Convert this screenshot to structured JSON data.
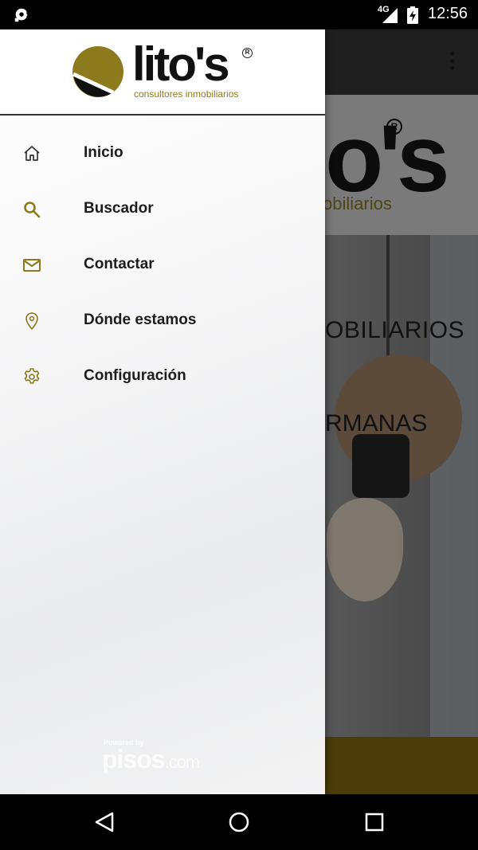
{
  "status_bar": {
    "network": "4G",
    "time": "12:56",
    "icons": [
      "notification-icon",
      "signal-icon",
      "battery-icon"
    ]
  },
  "background_app": {
    "logo_text": "o's",
    "logo_subtitle": "obiliarios",
    "headline_1": "OBILIARIOS",
    "headline_2": "RMANAS"
  },
  "drawer": {
    "logo": {
      "name": "lito's",
      "tagline": "consultores inmobiliarios"
    },
    "items": [
      {
        "label": "Inicio",
        "icon": "home-icon"
      },
      {
        "label": "Buscador",
        "icon": "search-icon"
      },
      {
        "label": "Contactar",
        "icon": "mail-icon"
      },
      {
        "label": "Dónde estamos",
        "icon": "location-pin-icon"
      },
      {
        "label": "Configuración",
        "icon": "gear-icon"
      }
    ],
    "watermark": {
      "powered_by": "Powered by",
      "brand": "pisos",
      "brand_suffix": ".com"
    }
  },
  "nav_bar": {
    "buttons": [
      "back-button",
      "home-button",
      "recents-button"
    ]
  },
  "colors": {
    "accent": "#8c7a1c",
    "drawer_text": "#1d1d1d",
    "status_bar": "#000000",
    "footer_bar": "#4a3d0a"
  }
}
